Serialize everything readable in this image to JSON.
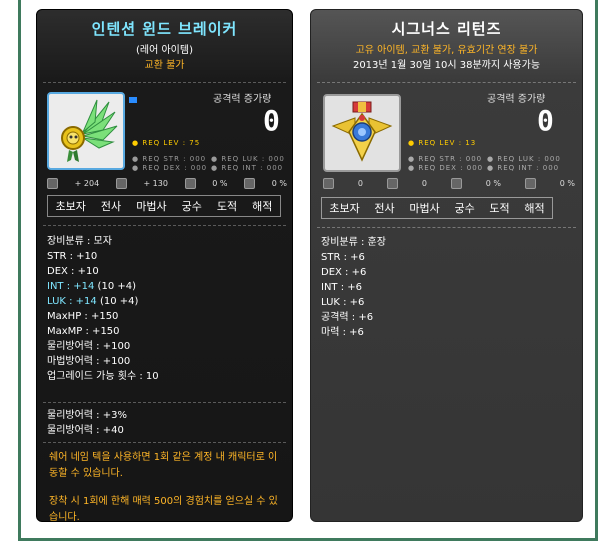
{
  "left": {
    "title": "인텐션 윈드 브레이커",
    "rarity": "(레어 아이템)",
    "trade": "교환 불가",
    "atk_label": "공격력 증가량",
    "atk_value": "0",
    "req_lev": "● REQ LEV :   75",
    "req_str": "● REQ STR : 000",
    "req_luk": "● REQ LUK : 000",
    "req_dex": "● REQ DEX : 000",
    "req_int": "● REQ INT : 000",
    "v1": "+ 204",
    "v2": "+ 130",
    "v3": "0 %",
    "v4": "0 %",
    "jobs": [
      "초보자",
      "전사",
      "마법사",
      "궁수",
      "도적",
      "해적"
    ],
    "stats": {
      "category": "장비분류 : 모자",
      "str": "STR : +10",
      "dex": "DEX : +10",
      "int_main": "INT : +14",
      "int_detail": " (10 +4)",
      "luk_main": "LUK : +14",
      "luk_detail": " (10 +4)",
      "maxhp": "MaxHP : +150",
      "maxmp": "MaxMP : +150",
      "pdef": "물리방어력 : +100",
      "mdef": "마법방어력 : +100",
      "upgrade": "업그레이드 가능 횟수 : 10"
    },
    "extra": {
      "pdef_pct": "물리방어력 : +3%",
      "pdef_add": "물리방어력 : +40"
    },
    "desc1": "쉐어 네임 텍을 사용하면 1회 같은 계정 내 캐릭터로 이동할 수 있습니다.",
    "desc2": "장착 시 1회에 한해 매력 500의 경험치를 얻으실 수 있습니다."
  },
  "right": {
    "title": "시그너스 리턴즈",
    "notice": "고유 아이템, 교환 불가, 유효기간 연장 불가",
    "expiry": "2013년 1월 30일 10시 38분까지 사용가능",
    "atk_label": "공격력 증가량",
    "atk_value": "0",
    "req_lev": "● REQ LEV :   13",
    "req_str": "● REQ STR : 000",
    "req_luk": "● REQ LUK : 000",
    "req_dex": "● REQ DEX : 000",
    "req_int": "● REQ INT : 000",
    "v1": "0",
    "v2": "0",
    "v3": "0 %",
    "v4": "0 %",
    "jobs": [
      "초보자",
      "전사",
      "마법사",
      "궁수",
      "도적",
      "해적"
    ],
    "stats": {
      "category": "장비분류 : 훈장",
      "str": "STR : +6",
      "dex": "DEX : +6",
      "int": "INT : +6",
      "luk": "LUK : +6",
      "atk": "공격력 : +6",
      "mag": "마력 : +6"
    }
  },
  "colors": {
    "cyan": "#7fe6ff",
    "orange": "#ffb627",
    "frame": "#3f7a5d"
  }
}
